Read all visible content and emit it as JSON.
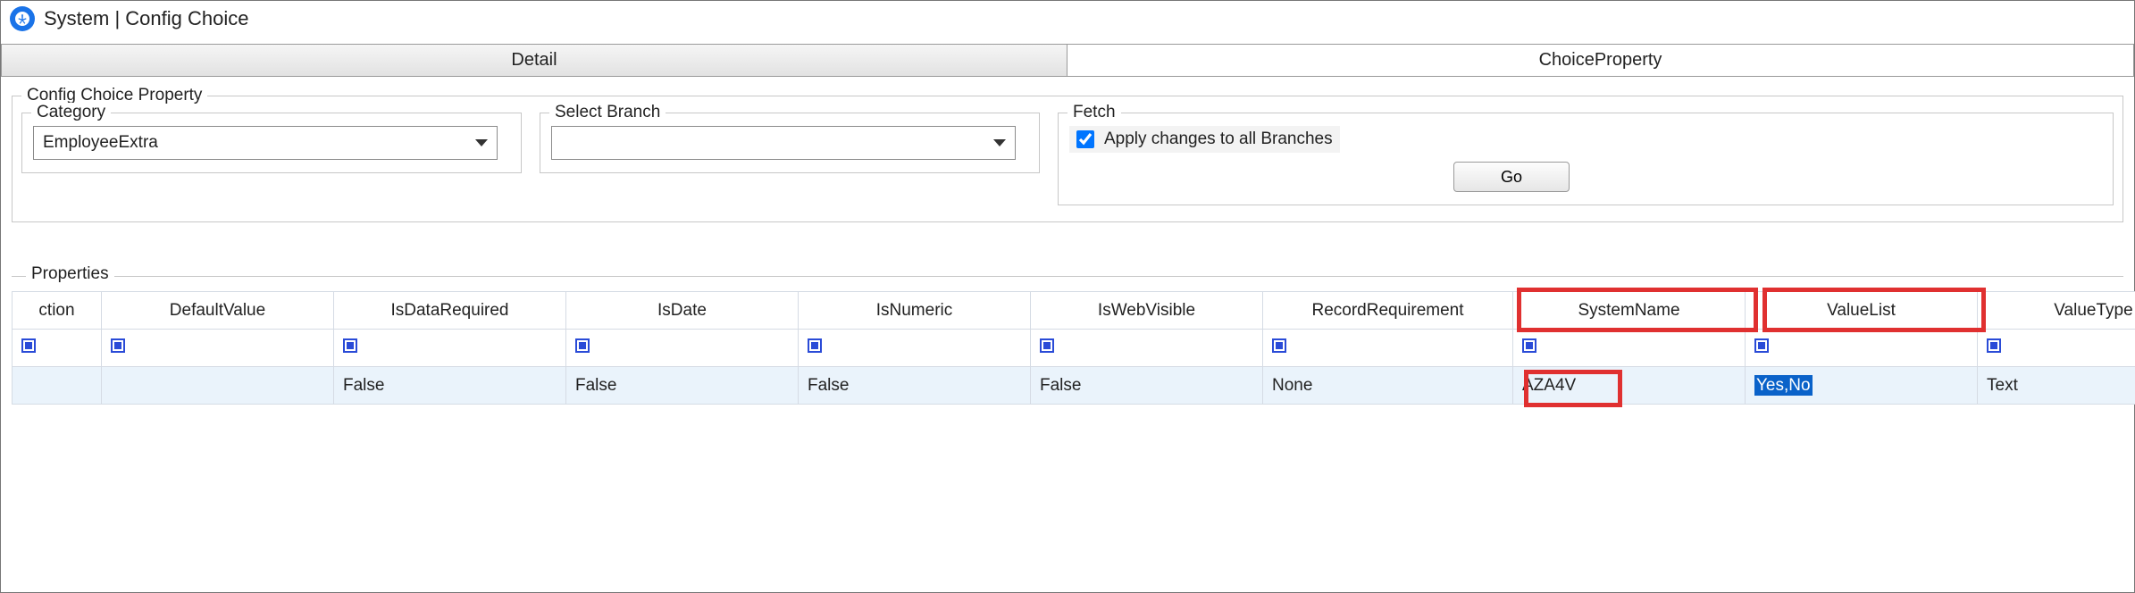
{
  "window": {
    "title": "System | Config Choice"
  },
  "tabs": {
    "detail": "Detail",
    "choice_property": "ChoiceProperty"
  },
  "config_group": {
    "legend": "Config Choice Property",
    "category_label": "Category",
    "category_value": "EmployeeExtra",
    "branch_label": "Select Branch",
    "branch_value": "",
    "fetch_label": "Fetch",
    "apply_all_label": "Apply changes to all Branches",
    "apply_all_checked": true,
    "go_label": "Go"
  },
  "properties": {
    "legend": "Properties",
    "headers": [
      "ction",
      "DefaultValue",
      "IsDataRequired",
      "IsDate",
      "IsNumeric",
      "IsWebVisible",
      "RecordRequirement",
      "SystemName",
      "ValueList",
      "ValueType"
    ],
    "row": {
      "ction": "",
      "DefaultValue": "",
      "IsDataRequired": "False",
      "IsDate": "False",
      "IsNumeric": "False",
      "IsWebVisible": "False",
      "RecordRequirement": "None",
      "SystemName": "AZA4V",
      "ValueList": "Yes,No",
      "ValueType": "Text"
    }
  }
}
